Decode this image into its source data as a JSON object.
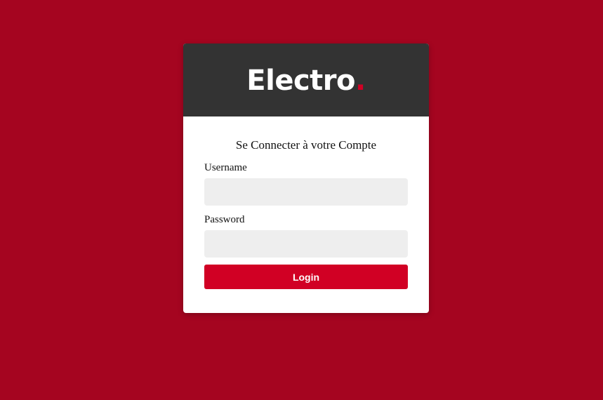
{
  "brand": {
    "name": "Electro",
    "dot": ".",
    "accent_color": "#d10024",
    "header_color": "#333333",
    "background_color": "#a50520"
  },
  "form": {
    "title": "Se Connecter à votre Compte",
    "username_label": "Username",
    "username_value": "",
    "password_label": "Password",
    "password_value": "",
    "login_label": "Login"
  }
}
